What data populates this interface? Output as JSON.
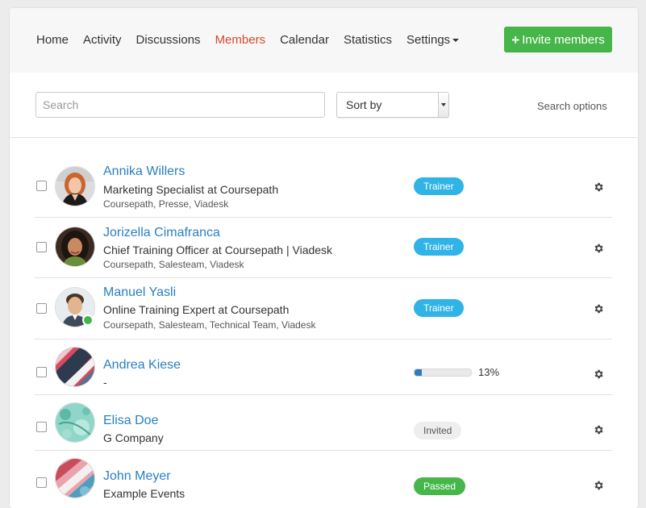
{
  "nav": {
    "items": [
      {
        "label": "Home"
      },
      {
        "label": "Activity"
      },
      {
        "label": "Discussions"
      },
      {
        "label": "Members",
        "active": true
      },
      {
        "label": "Calendar"
      },
      {
        "label": "Statistics"
      },
      {
        "label": "Settings",
        "dropdown": true
      }
    ],
    "invite_button": {
      "icon": "plus-icon",
      "label": "Invite members"
    }
  },
  "toolbar": {
    "search_placeholder": "Search",
    "search_value": "",
    "sort_label": "Sort by",
    "search_options_label": "Search options"
  },
  "colors": {
    "accent_active_nav": "#d9472b",
    "link_blue": "#2a7fc1",
    "trainer_badge": "#30b3e6",
    "passed_badge": "#47b64a",
    "invite_button": "#47b64a",
    "online_status": "#3fb64b"
  },
  "members": [
    {
      "name": "Annika Willers",
      "title": "Marketing Specialist at Coursepath",
      "groups": "Coursepath, Presse, Viadesk",
      "status": {
        "kind": "badge",
        "label": "Trainer"
      },
      "online": false
    },
    {
      "name": "Jorizella Cimafranca",
      "title": "Chief Training Officer at Coursepath | Viadesk",
      "groups": "Coursepath, Salesteam, Viadesk",
      "status": {
        "kind": "badge",
        "label": "Trainer"
      },
      "online": false
    },
    {
      "name": "Manuel Yasli",
      "title": "Online Training Expert at Coursepath",
      "groups": "Coursepath, Salesteam, Technical Team, Viadesk",
      "status": {
        "kind": "badge",
        "label": "Trainer"
      },
      "online": true
    },
    {
      "name": "Andrea Kiese",
      "title": "-",
      "groups": "",
      "status": {
        "kind": "progress",
        "value": 13,
        "label": "13%"
      },
      "online": false
    },
    {
      "name": "Elisa Doe",
      "title": "G Company",
      "groups": "",
      "status": {
        "kind": "badge",
        "label": "Invited"
      },
      "online": false
    },
    {
      "name": "John Meyer",
      "title": "Example Events",
      "groups": "",
      "status": {
        "kind": "badge",
        "label": "Passed"
      },
      "online": false
    }
  ]
}
